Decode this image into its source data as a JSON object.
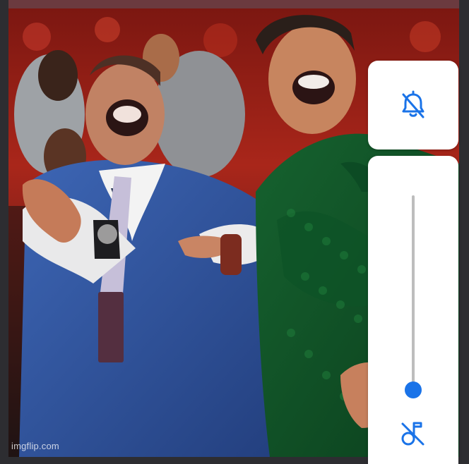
{
  "photo": {
    "watermark": "imgflip.com"
  },
  "volume_controls": {
    "mute_icon": "bell-off-icon",
    "music_icon": "music-note-off-icon",
    "volume_level": 0.0,
    "accent_color": "#1a73e8"
  }
}
